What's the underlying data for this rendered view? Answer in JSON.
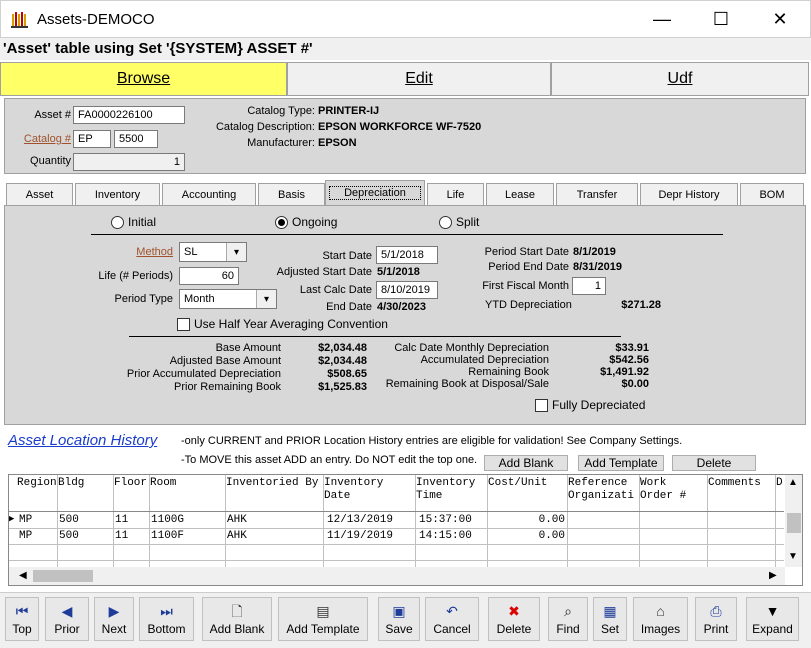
{
  "window": {
    "title": "Assets-DEMOCO",
    "minimize": "—",
    "maximize": "☐",
    "close": "✕"
  },
  "heading": "'Asset' table using Set '{SYSTEM} ASSET #'",
  "main_tabs": [
    "Browse",
    "Edit",
    "Udf"
  ],
  "record": {
    "asset_label": "Asset #",
    "asset_value": "FA0000226100",
    "catalog_label": "Catalog #",
    "catalog_value1": "EP",
    "catalog_value2": "5500",
    "quantity_label": "Quantity",
    "quantity_value": "1",
    "catalog_type_label": "Catalog Type:",
    "catalog_type_value": "PRINTER-IJ",
    "catalog_desc_label": "Catalog Description:",
    "catalog_desc_value": "EPSON WORKFORCE WF-7520",
    "manufacturer_label": "Manufacturer:",
    "manufacturer_value": "EPSON"
  },
  "sub_tabs": [
    "Asset",
    "Inventory",
    "Accounting",
    "Basis",
    "Depreciation",
    "Life",
    "Lease",
    "Transfer",
    "Depr History",
    "BOM"
  ],
  "depreciation": {
    "radio_initial": "Initial",
    "radio_ongoing": "Ongoing",
    "radio_split": "Split",
    "method_label": "Method",
    "method_value": "SL",
    "life_label": "Life (# Periods)",
    "life_value": "60",
    "period_type_label": "Period Type",
    "period_type_value": "Month",
    "half_year_label": "Use Half Year Averaging Convention",
    "start_date_label": "Start Date",
    "start_date_value": "5/1/2018",
    "adj_start_label": "Adjusted Start Date",
    "adj_start_value": "5/1/2018",
    "last_calc_label": "Last Calc Date",
    "last_calc_value": "8/10/2019",
    "end_date_label": "End Date",
    "end_date_value": "4/30/2023",
    "period_start_label": "Period Start Date",
    "period_start_value": "8/1/2019",
    "period_end_label": "Period End Date",
    "period_end_value": "8/31/2019",
    "first_fiscal_label": "First Fiscal Month",
    "first_fiscal_value": "1",
    "ytd_label": "YTD Depreciation",
    "ytd_value": "$271.28",
    "base_amount_label": "Base Amount",
    "base_amount_value": "$2,034.48",
    "adj_base_label": "Adjusted Base Amount",
    "adj_base_value": "$2,034.48",
    "prior_accum_label": "Prior Accumulated Depreciation",
    "prior_accum_value": "$508.65",
    "prior_remaining_label": "Prior Remaining Book",
    "prior_remaining_value": "$1,525.83",
    "calc_monthly_label": "Calc Date Monthly Depreciation",
    "calc_monthly_value": "$33.91",
    "accum_label": "Accumulated Depreciation",
    "accum_value": "$542.56",
    "remaining_label": "Remaining Book",
    "remaining_value": "$1,491.92",
    "remaining_disposal_label": "Remaining Book at Disposal/Sale",
    "remaining_disposal_value": "$0.00",
    "fully_label": "Fully Depreciated"
  },
  "history": {
    "title": "Asset Location History",
    "note1": "-only CURRENT and PRIOR Location History entries are eligible for validation! See Company Settings.",
    "note2": "-To MOVE this asset ADD an entry. Do NOT edit the top one.",
    "add_blank": "Add Blank",
    "add_template": "Add Template",
    "delete": "Delete",
    "columns": [
      "Region",
      "Bldg",
      "Floor",
      "Room",
      "Inventoried By",
      "Inventory Date",
      "Inventory Time",
      "Cost/Unit",
      "Reference Organizati",
      "Work Order #",
      "Comments",
      "D"
    ],
    "rows": [
      [
        "MP",
        "500",
        "11",
        "1100G",
        "AHK",
        "12/13/2019",
        "15:37:00",
        "0.00"
      ],
      [
        "MP",
        "500",
        "11",
        "1100F",
        "AHK",
        "11/19/2019",
        "14:15:00",
        "0.00"
      ]
    ]
  },
  "toolbar": [
    "Top",
    "Prior",
    "Next",
    "Bottom",
    "Add Blank",
    "Add Template",
    "Save",
    "Cancel",
    "Delete",
    "Find",
    "Set",
    "Images",
    "Print",
    "Expand"
  ]
}
